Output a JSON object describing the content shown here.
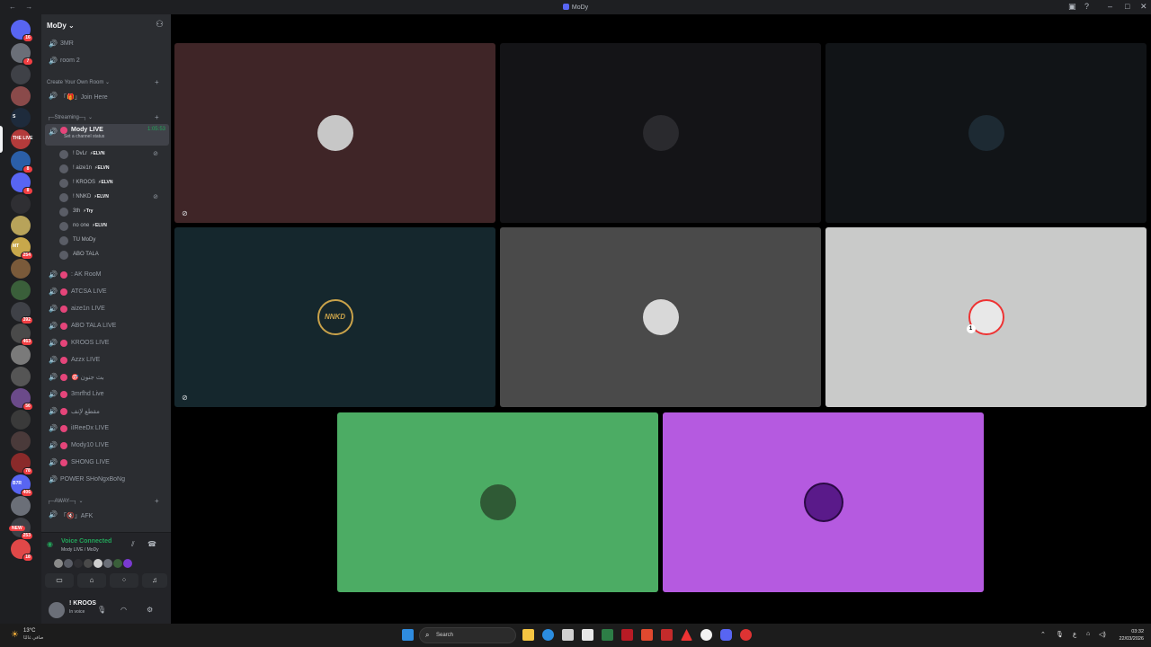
{
  "window": {
    "title": "MoDy",
    "nav_arrows": "← →"
  },
  "guild_badges": [
    "16",
    "7",
    "",
    "",
    "",
    "",
    "8",
    "8",
    "",
    "",
    "254",
    "",
    "",
    "392",
    "463",
    "",
    "",
    "56",
    "",
    "",
    "78",
    "406",
    "",
    "253",
    "18"
  ],
  "guild_labels": [
    "S",
    "THE LIVE",
    "MT",
    "B7R",
    "NEW"
  ],
  "server": {
    "name": "MoDy"
  },
  "channels_top": [
    {
      "label": "3MR"
    },
    {
      "label": "room 2"
    }
  ],
  "category_create": "Create Your Own Room",
  "join_here": "「🎁」Join Here",
  "category_streaming": "┌─Streaming─┐",
  "active_channel": {
    "label": "Mody LIVE",
    "status": "Set a channel status",
    "timer": "1:05:53"
  },
  "members": [
    {
      "name": "! DvLr",
      "tag": "ELVN",
      "muted": true
    },
    {
      "name": "! aize1n",
      "tag": "ELVN",
      "muted": false
    },
    {
      "name": "! KROOS",
      "tag": "ELVN",
      "muted": false
    },
    {
      "name": "! NNKD",
      "tag": "ELVN",
      "muted": true
    },
    {
      "name": "3th",
      "tag": "Try",
      "muted": false
    },
    {
      "name": "no one",
      "tag": "ELVN",
      "muted": false
    },
    {
      "name": "TU MoDy",
      "tag": "",
      "muted": false
    },
    {
      "name": "ABO TALA",
      "tag": "",
      "muted": false
    }
  ],
  "live_channels": [
    {
      "label": ": AK RooM"
    },
    {
      "label": "ATCSA LIVE"
    },
    {
      "label": "aize1n LIVE"
    },
    {
      "label": "ABO TALA LIVE"
    },
    {
      "label": "KROOS LIVE"
    },
    {
      "label": "Azzx LIVE"
    },
    {
      "label": "🎯 بث جنون"
    },
    {
      "label": "3mrfhd Live"
    },
    {
      "label": "مقطع لإنف"
    },
    {
      "label": "iIReeDx LIVE"
    },
    {
      "label": "Mody10 LIVE"
    },
    {
      "label": "SHONG LIVE"
    },
    {
      "label": "POWER SHoNgxBoNg",
      "no_dot": true
    }
  ],
  "category_away": "┌─AWAY─┐",
  "afk": "「🔇」AFK",
  "voice": {
    "state": "Voice Connected",
    "where": "Mody LIVE / MoDy"
  },
  "user": {
    "name": "! KROOS",
    "status": "In voice"
  },
  "tiles": [
    {
      "bg": "#3f2527",
      "muted": true
    },
    {
      "bg": "#141417",
      "muted": false
    },
    {
      "bg": "#111417",
      "muted": false
    },
    {
      "bg": "#15272d",
      "muted": true,
      "initials": "NNKD"
    },
    {
      "bg": "#4a4a4a",
      "muted": false
    },
    {
      "bg": "#c9cac9",
      "muted": false,
      "badge": "1"
    },
    {
      "bg": "#4cac64",
      "muted": false
    },
    {
      "bg": "#b55ae0",
      "muted": false
    }
  ],
  "taskbar": {
    "weather_temp": "13°C",
    "weather_cond": "صافي غالبًا",
    "search": "Search",
    "time": "03:32",
    "date": "22/03/2026",
    "lang": "ع"
  }
}
